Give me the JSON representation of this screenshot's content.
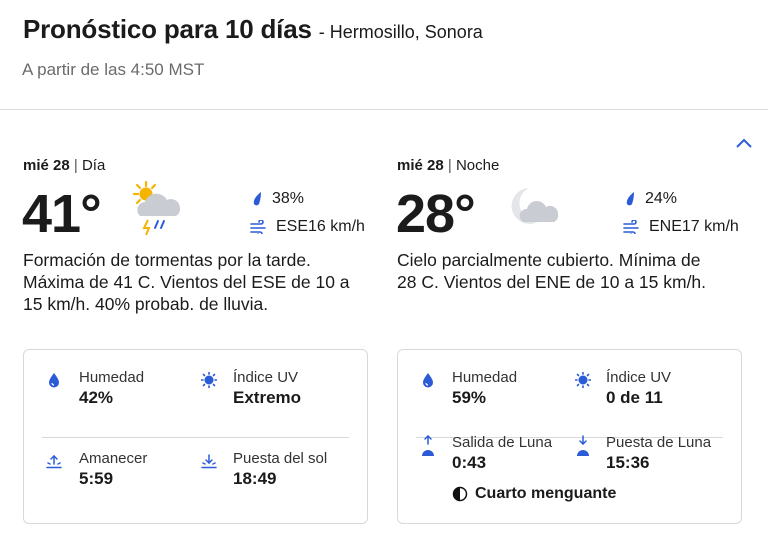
{
  "header": {
    "title": "Pronóstico para 10 días",
    "location": "- Hermosillo, Sonora",
    "updated": "A partir de las 4:50 MST"
  },
  "day": {
    "date": "mié 28",
    "period": "Día",
    "temp": "41°",
    "icon": "sun-cloud-thunder-icon",
    "precip": "38%",
    "wind": "ESE16 km/h",
    "desc": "Formación de tormentas por la tarde. Máxima de 41 C. Vientos del ESE de 10 a 15 km/h. 40% probab. de lluvia.",
    "card": {
      "humidity_label": "Humedad",
      "humidity": "42%",
      "uv_label": "Índice UV",
      "uv": "Extremo",
      "rise_label": "Amanecer",
      "rise": "5:59",
      "set_label": "Puesta del sol",
      "set": "18:49"
    }
  },
  "night": {
    "date": "mié 28",
    "period": "Noche",
    "temp": "28°",
    "icon": "moon-cloud-icon",
    "precip": "24%",
    "wind": "ENE17 km/h",
    "desc": "Cielo parcialmente cubierto. Mínima de 28 C. Vientos del ENE de 10 a 15 km/h.",
    "card": {
      "humidity_label": "Humedad",
      "humidity": "59%",
      "uv_label": "Índice UV",
      "uv": "0 de 11",
      "rise_label": "Salida de Luna",
      "rise": "0:43",
      "set_label": "Puesta de Luna",
      "set": "15:36",
      "moon_phase": "Cuarto menguante"
    }
  },
  "colors": {
    "accent": "#2b5bd7",
    "text": "#1b1b1b",
    "muted": "#6b6b6b",
    "border": "#d9d9d9"
  }
}
